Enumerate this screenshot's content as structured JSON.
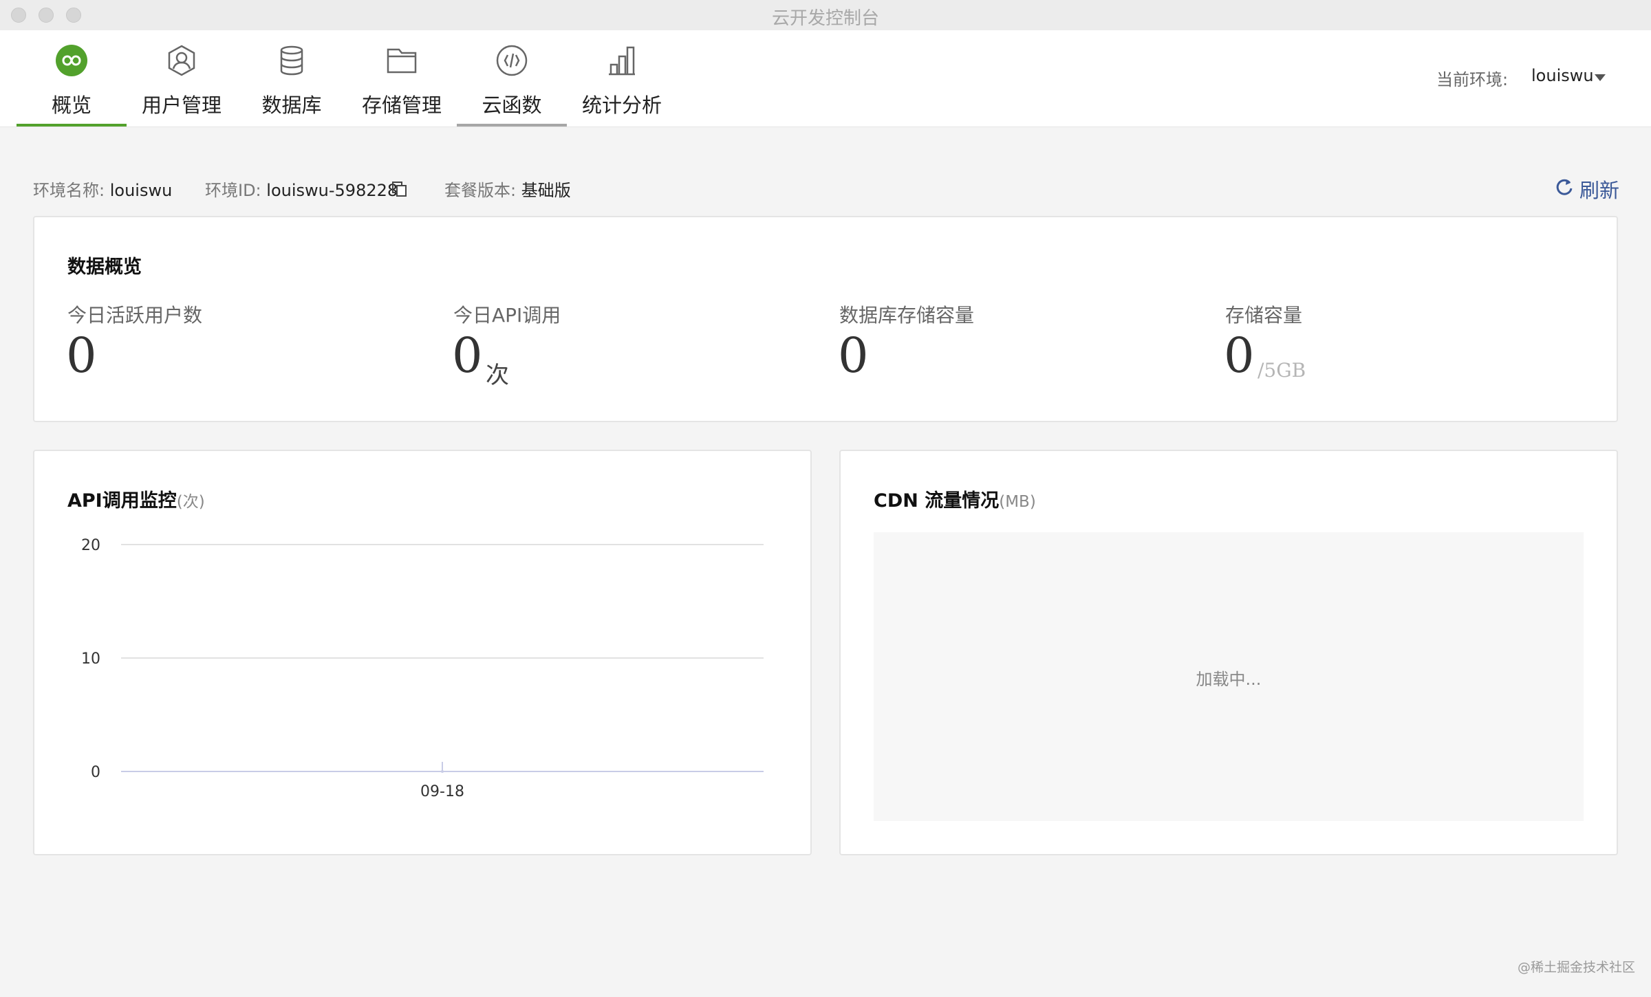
{
  "window": {
    "title": "云开发控制台"
  },
  "nav": {
    "items": [
      {
        "label": "概览",
        "icon": "infinity-icon",
        "active": true
      },
      {
        "label": "用户管理",
        "icon": "user-icon",
        "active": false
      },
      {
        "label": "数据库",
        "icon": "database-icon",
        "active": false
      },
      {
        "label": "存储管理",
        "icon": "folder-icon",
        "active": false
      },
      {
        "label": "云函数",
        "icon": "function-icon",
        "active": false,
        "hover": true
      },
      {
        "label": "统计分析",
        "icon": "bar-chart-icon",
        "active": false
      }
    ],
    "env_label": "当前环境:",
    "env_value": "louiswu"
  },
  "info": {
    "env_name_label": "环境名称:",
    "env_name": "louiswu",
    "env_id_label": "环境ID:",
    "env_id": "louiswu-598228",
    "plan_label": "套餐版本:",
    "plan": "基础版",
    "refresh_label": "刷新"
  },
  "overview": {
    "title": "数据概览",
    "metrics": [
      {
        "label": "今日活跃用户数",
        "value": "0",
        "unit": ""
      },
      {
        "label": "今日API调用",
        "value": "0",
        "unit": "次"
      },
      {
        "label": "数据库存储容量",
        "value": "0",
        "unit": ""
      },
      {
        "label": "存储容量",
        "value": "0",
        "unit": "/5GB"
      }
    ]
  },
  "api_card": {
    "title": "API调用监控",
    "unit": "(次)"
  },
  "cdn_card": {
    "title": "CDN 流量情况",
    "unit": "(MB)",
    "loading": "加载中..."
  },
  "chart_data": {
    "type": "line",
    "title": "API调用监控(次)",
    "xlabel": "",
    "ylabel": "",
    "x": [
      "09-18"
    ],
    "series": [
      {
        "values": [
          0
        ]
      }
    ],
    "ylim": [
      0,
      20
    ],
    "yticks": [
      0,
      10,
      20
    ],
    "grid": true
  },
  "colors": {
    "accent": "#52a12c",
    "link": "#3b5998"
  },
  "watermark": "@稀土掘金技术社区"
}
